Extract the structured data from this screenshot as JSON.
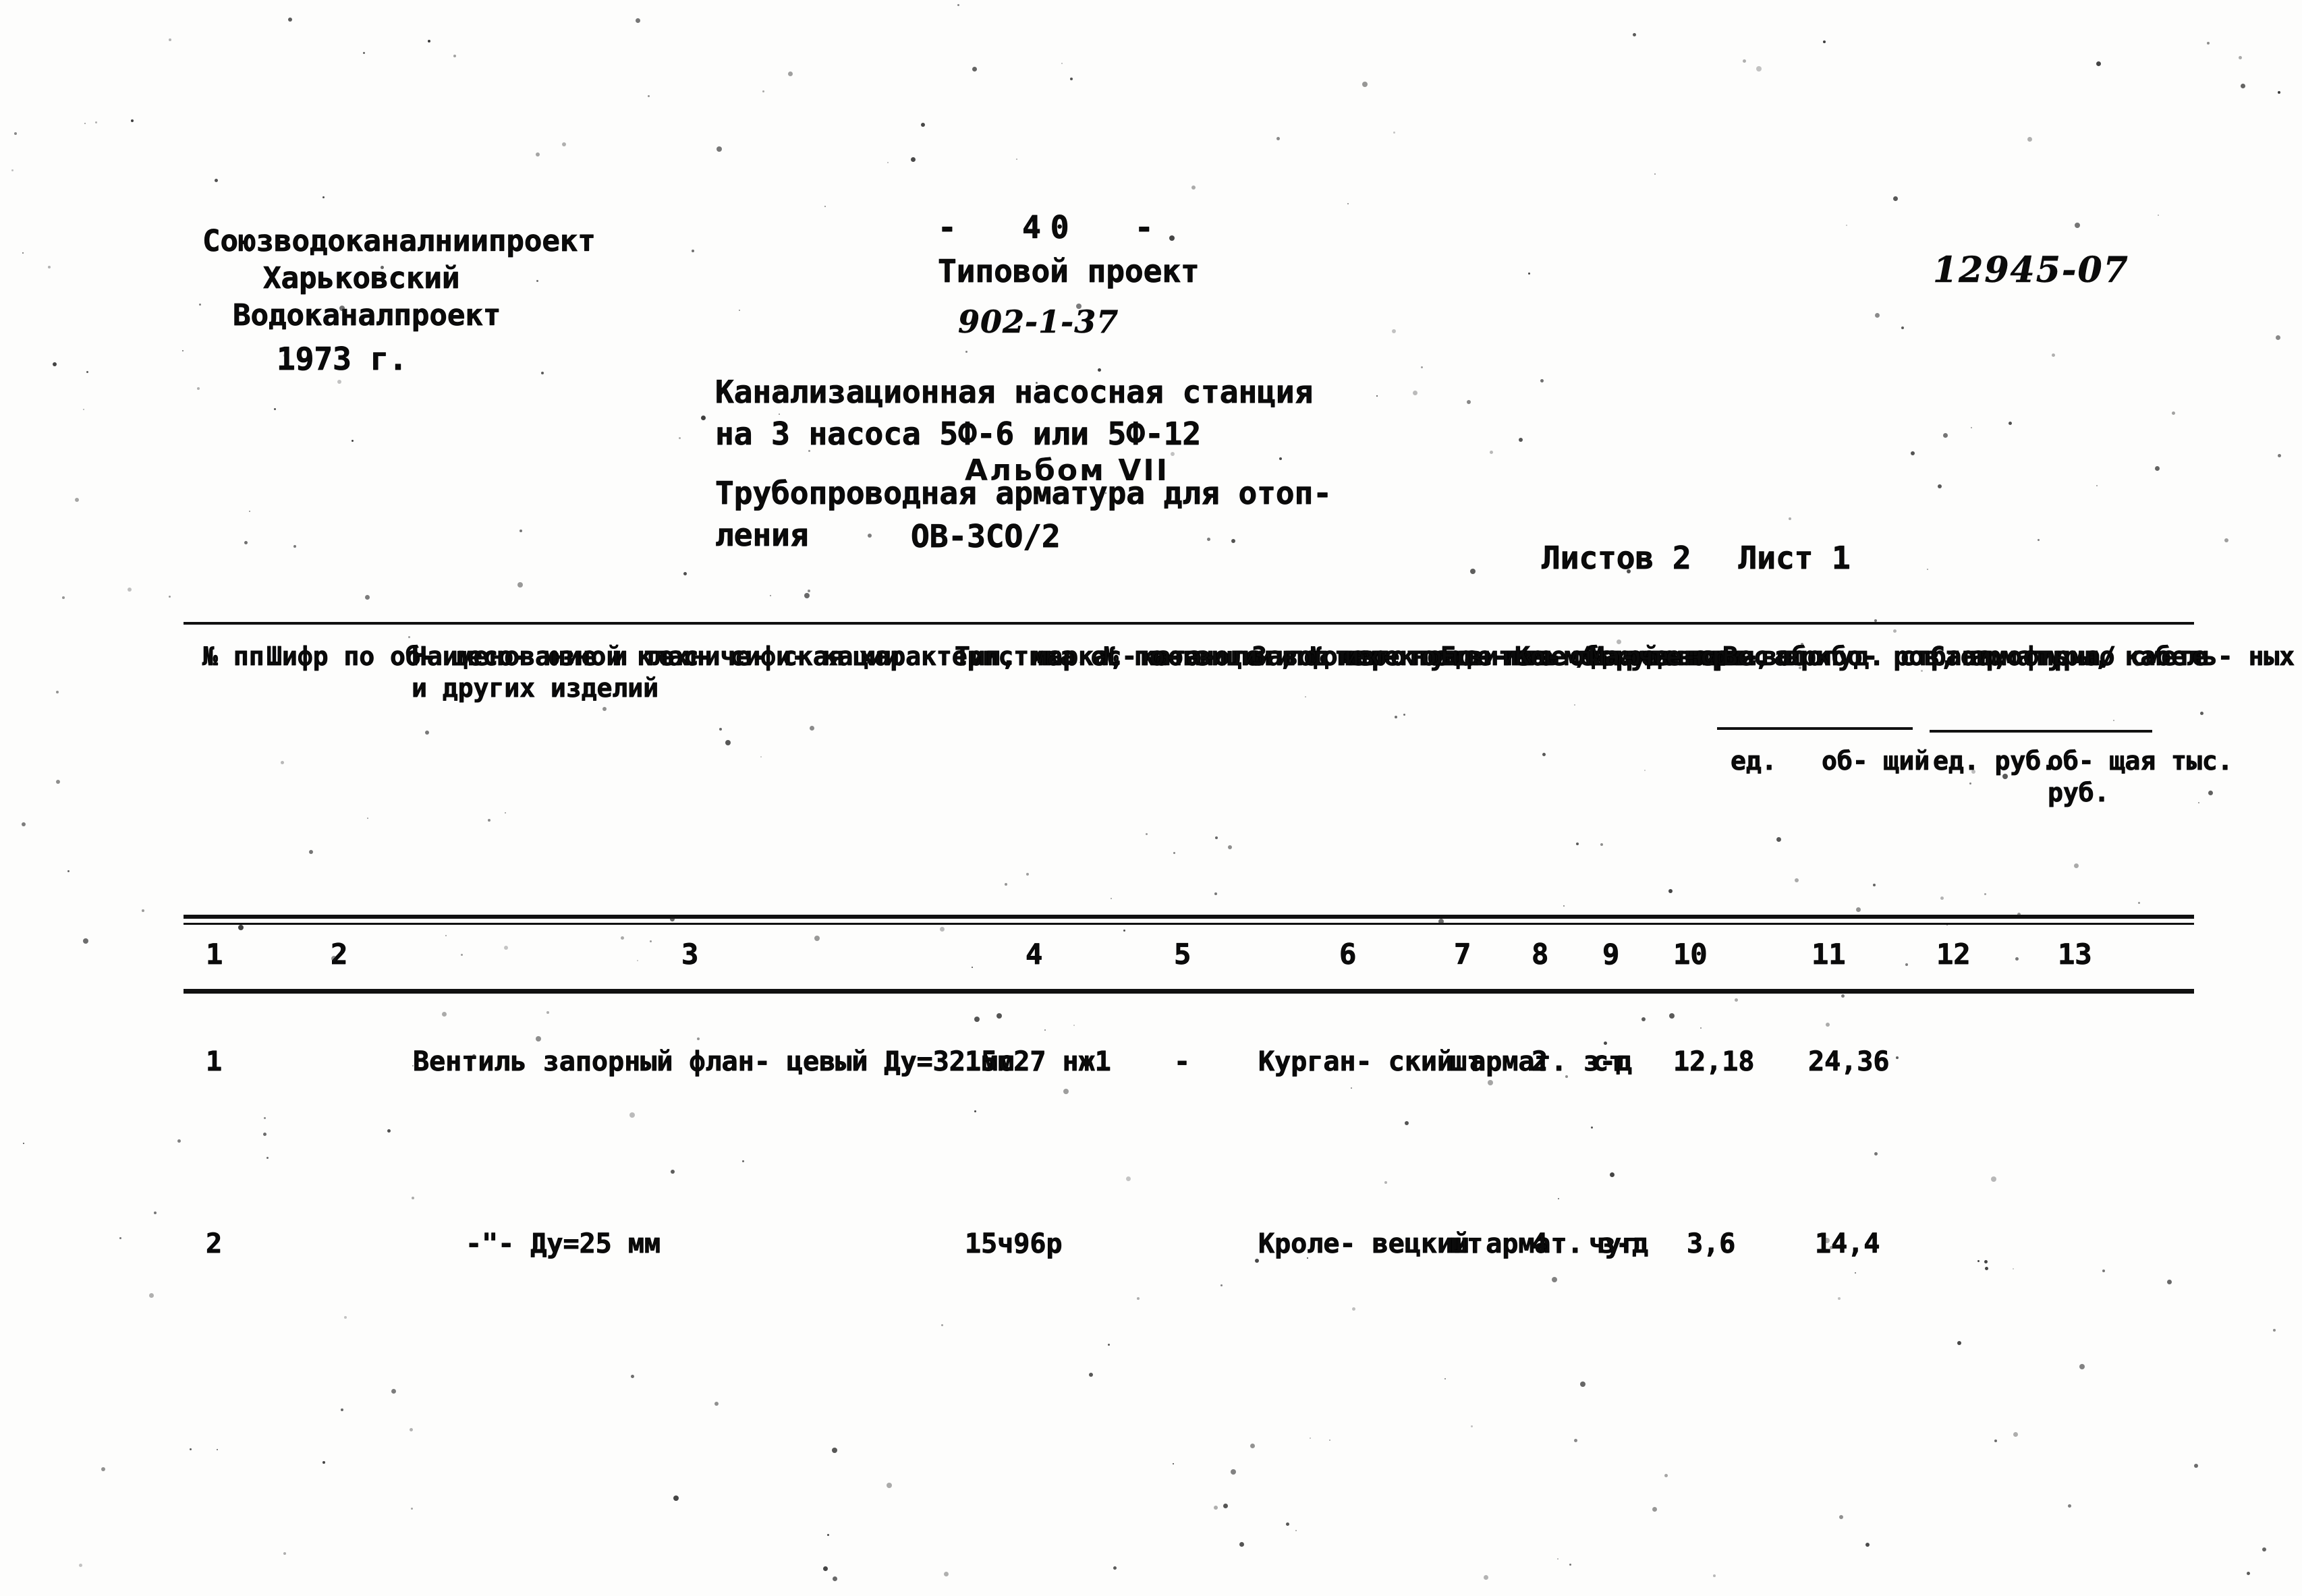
{
  "header": {
    "organization_line1": "Союзводоканалниипроект",
    "organization_line2": "Харьковский",
    "organization_line3": "Водоканалпроект",
    "year": "1973 г.",
    "page_number": "-  40  -",
    "project_kind": "Типовой проект",
    "project_code": "902-1-37",
    "document_number": "12945-07",
    "object_line1": "Канализационная насосная станция",
    "object_line2": "на 3 насоса 5Ф-6 или 5Ф-12",
    "album": "Альбом VII",
    "section_line1": "Трубопроводная арматура для отоп-",
    "section_line2": "ления",
    "section_code": "ОВ-3СО/2",
    "sheets_total_label": "Листов 2",
    "sheet_label": "Лист 1"
  },
  "table": {
    "headers": {
      "col1": "№\nпп",
      "col2": "Шифр\nпо об-\nщесо-\nюзной\nклас-\nсифи-\nкации",
      "col3": "Наименование и техниче-\nская характеристика ос-\nновного и комплектуюте-\nго оборудования, прибо-\nров, арматуры, кабель-\nных и других изделий",
      "col4": "Тип,\nмарка,\nката-\nлог,\n№\nчер-\nтежа",
      "col5": "№ по-\nзиции\nпо\nтех-\nноло-\nгиче-\nской",
      "col6": "Завод\nизгото-\nвитель\n/для\nимпорт.\nобогуд.\nстрана,\nфирма/",
      "col7": "Ед.\nиз-\nме-\nре-\nния",
      "col8": "Ко-\nли-\nче-\nст-\nво",
      "col9": "Ма-\nте-\nри-\nал",
      "group_weight": "Вес в кг",
      "group_cost": "Стоимость\nпо смете",
      "col10": "ед.",
      "col11": "об-\nщий",
      "col12": "ед.\nруб.",
      "col13": "об-\nщая\nтыс.\nруб."
    },
    "column_numbers": [
      "1",
      "2",
      "3",
      "4",
      "5",
      "6",
      "7",
      "8",
      "9",
      "10",
      "11",
      "12",
      "13"
    ],
    "rows": [
      {
        "no": "1",
        "code": "",
        "name_line1": "Вентиль запорный флан-",
        "name_line2": "цевый Ду=32 мм",
        "type_line1": "15с27",
        "type_line2": "нж1",
        "position": "-",
        "maker_line1": "Курган-",
        "maker_line2": "ский",
        "maker_line3": "армат.",
        "maker_line4": "з-д",
        "unit": "шт",
        "qty": "2",
        "material": "ст",
        "weight_unit": "12,18",
        "weight_total": "24,36",
        "cost_unit": "",
        "cost_total": ""
      },
      {
        "no": "2",
        "code": "",
        "name_line1": "-\"-   Ду=25 мм",
        "name_line2": "",
        "type_line1": "15ч96р",
        "type_line2": "",
        "position": "",
        "maker_line1": "Кроле-",
        "maker_line2": "вецкий",
        "maker_line3": "армат.",
        "maker_line4": "з-д",
        "unit": "шт",
        "qty": "4",
        "material": "чуг",
        "weight_unit": "3,6",
        "weight_total": "14,4",
        "cost_unit": "",
        "cost_total": ""
      }
    ]
  }
}
